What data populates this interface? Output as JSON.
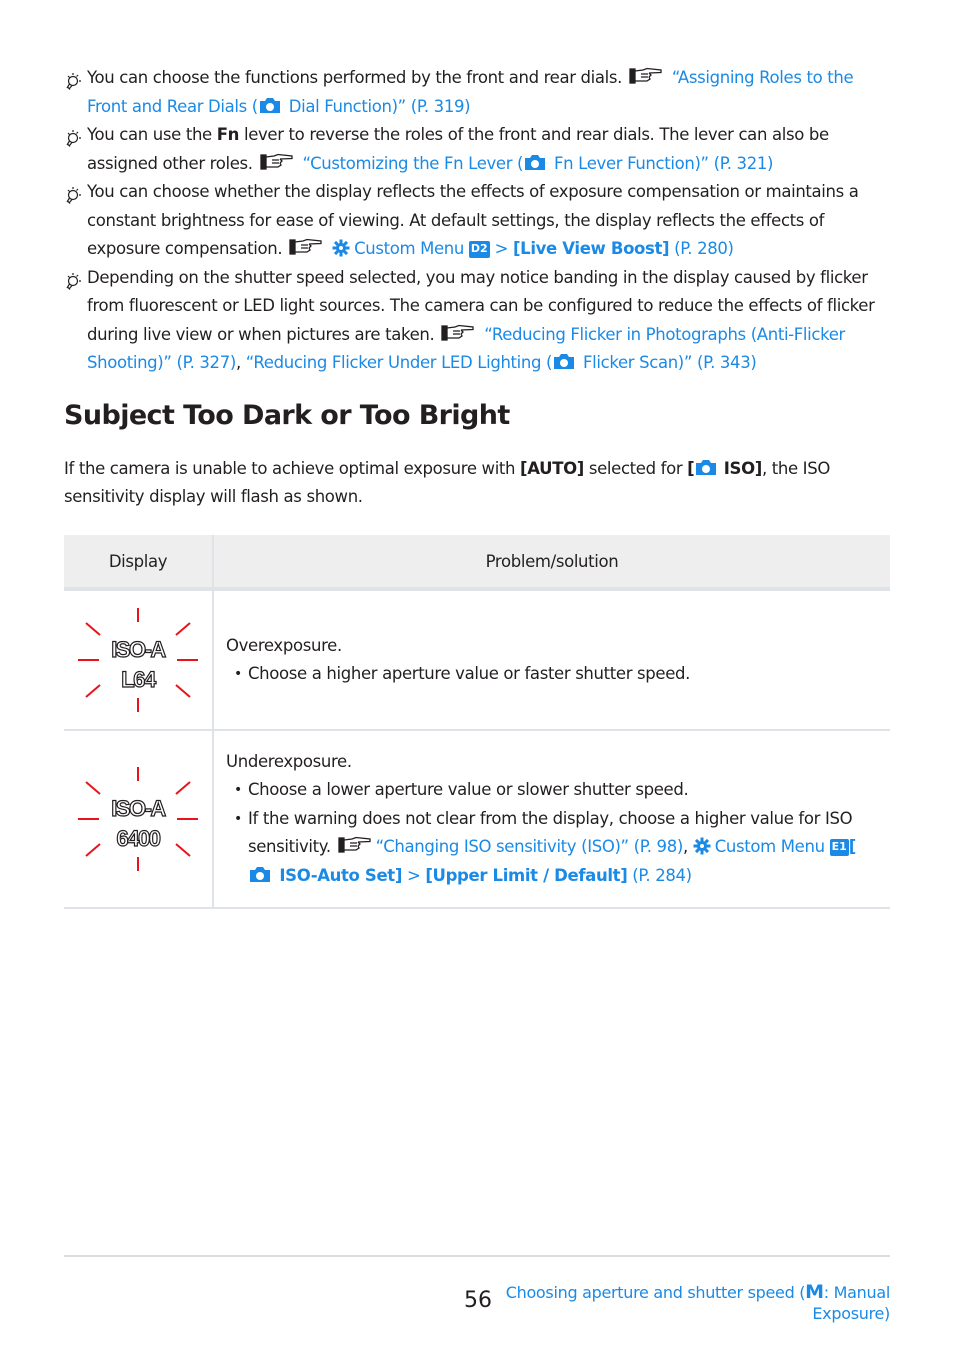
{
  "tips": [
    {
      "text_before": "You can choose the functions performed by the front and rear dials.",
      "link_part1": "“Assigning Roles to the Front and Rear Dials (",
      "link_part2": " Dial Function)” (P. 319)"
    },
    {
      "text_a": "You can use the ",
      "bold": "Fn",
      "text_b": " lever to reverse the roles of the front and rear dials. The lever can also be assigned other roles.",
      "link_part1": "“Customizing the Fn Lever (",
      "link_part2": " Fn Lever Function)” (P. 321)"
    },
    {
      "text_before": "You can choose whether the display reflects the effects of exposure compensation or maintains a constant brightness for ease of viewing. At default settings, the display reflects the effects of exposure compensation.",
      "menu_label": "Custom Menu",
      "menu_tag": "D2",
      "separator": ">",
      "item": "[Live View Boost]",
      "page": "(P. 280)"
    },
    {
      "text_before": "Depending on the shutter speed selected, you may notice banding in the display caused by flicker from fluorescent or LED light sources. The camera can be configured to reduce the effects of flicker during live view or when pictures are taken.",
      "link1": "“Reducing Flicker in Photographs (Anti-Flicker Shooting)” (P. 327)",
      "comma": ", ",
      "link2_part1": "“Reducing Flicker Under LED Lighting (",
      "link2_part2": " Flicker Scan)” (P. 343)"
    }
  ],
  "section": {
    "title": "Subject Too Dark or Too Bright",
    "intro_a": "If the camera is unable to achieve optimal exposure with ",
    "intro_bold1": "[AUTO]",
    "intro_b": " selected for ",
    "intro_bold2_open": "[",
    "intro_bold2_close": " ISO]",
    "intro_c": ", the ISO sensitivity display will flash as shown."
  },
  "table": {
    "headers": [
      "Display",
      "Problem/solution"
    ],
    "rows": [
      {
        "display_line1": "ISO-A",
        "display_line2": "L64",
        "problem": "Overexposure.",
        "bullets": [
          "Choose a higher aperture value or faster shutter speed."
        ]
      },
      {
        "display_line1": "ISO-A",
        "display_line2": "6400",
        "problem": "Underexposure.",
        "bullets": [
          "Choose a lower aperture value or slower shutter speed.",
          "If the warning does not clear from the display, choose a higher value for ISO sensitivity."
        ],
        "link": "“Changing ISO sensitivity (ISO)” (P. 98)",
        "comma": ",",
        "menu_label": "Custom Menu",
        "menu_tag": "E1",
        "item1_open": "[",
        "item1_close": " ISO-Auto Set]",
        "separator": ">",
        "item2": "[Upper Limit / Default]",
        "page": "(P. 284)"
      }
    ]
  },
  "footer": {
    "page_number": "56",
    "link_a": "Choosing aperture and shutter speed (",
    "link_m": "M",
    "link_b": ": Manual Exposure)"
  },
  "colors": {
    "link": "#1a8ae6",
    "flash": "#e8141c",
    "header_bg": "#eeeeee"
  }
}
